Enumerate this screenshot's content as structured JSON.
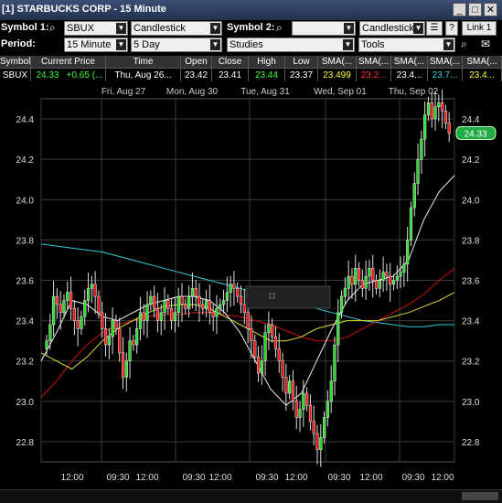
{
  "window": {
    "title": "[1] STARBUCKS CORP - 15 Minute",
    "buttons": [
      "_",
      "□",
      "✕"
    ]
  },
  "toolbar1": {
    "symbol1_label": "Symbol 1:",
    "symbol1_value": "SBUX",
    "chart_type": "Candlestick",
    "symbol2_label": "Symbol 2:",
    "symbol2_value": "",
    "chart_type2": "Candlestick",
    "help": "?",
    "link": "Link 1"
  },
  "toolbar2": {
    "period_label": "Period:",
    "period_value": "15 Minute",
    "range_value": "5 Day",
    "studies_value": "Studies",
    "tools_value": "Tools"
  },
  "quote": {
    "headers": [
      "Symbol",
      "Current Price",
      "Time",
      "Open",
      "Close",
      "High",
      "Low",
      "SMA(...",
      "SMA(...",
      "SMA(...",
      "SMA(...",
      "SMA(..."
    ],
    "values": [
      "SBUX",
      "24.33",
      "+0.65 (...",
      "Thu, Aug 26...",
      "23.42",
      "23.41",
      "23.44",
      "23.37",
      "23.499",
      "23.2...",
      "23.4...",
      "23.7...",
      "23.4..."
    ]
  },
  "chart_data": {
    "type": "candlestick",
    "symbol": "SBUX",
    "interval": "15 Minute",
    "date_labels": [
      "Fri, Aug 27",
      "Mon, Aug 30",
      "Tue, Aug 31",
      "Wed, Sep 01",
      "Thu, Sep 02"
    ],
    "time_labels": [
      "12:00",
      "09:30",
      "12:00",
      "09:30",
      "12:00",
      "09:30",
      "12:00",
      "09:30",
      "12:00",
      "09:30",
      "12:00"
    ],
    "y_ticks": [
      22.8,
      23.0,
      23.2,
      23.4,
      23.6,
      23.8,
      24.0,
      24.2,
      24.4
    ],
    "ylim": [
      22.7,
      24.5
    ],
    "x_count": 130,
    "last_price": "24.33",
    "grid": true,
    "closes": [
      23.3,
      23.38,
      23.52,
      23.48,
      23.44,
      23.5,
      23.54,
      23.46,
      23.4,
      23.36,
      23.42,
      23.5,
      23.56,
      23.58,
      23.52,
      23.44,
      23.36,
      23.28,
      23.32,
      23.4,
      23.36,
      23.24,
      23.12,
      23.2,
      23.3,
      23.28,
      23.36,
      23.44,
      23.4,
      23.48,
      23.52,
      23.46,
      23.4,
      23.44,
      23.5,
      23.46,
      23.4,
      23.44,
      23.52,
      23.48,
      23.46,
      23.52,
      23.56,
      23.52,
      23.48,
      23.46,
      23.5,
      23.44,
      23.42,
      23.46,
      23.48,
      23.5,
      23.54,
      23.58,
      23.56,
      23.52,
      23.48,
      23.44,
      23.36,
      23.3,
      23.22,
      23.14,
      23.2,
      23.34,
      23.38,
      23.32,
      23.26,
      23.2,
      23.12,
      23.04,
      23.1,
      23.0,
      22.92,
      22.96,
      23.04,
      22.98,
      22.9,
      22.84,
      22.76,
      22.82,
      22.92,
      23.0,
      23.1,
      23.28,
      23.44,
      23.52,
      23.56,
      23.62,
      23.58,
      23.66,
      23.6,
      23.56,
      23.62,
      23.66,
      23.6,
      23.56,
      23.6,
      23.64,
      23.62,
      23.58,
      23.6,
      23.62,
      23.64,
      23.68,
      23.8,
      23.96,
      24.08,
      24.2,
      24.3,
      24.42,
      24.48,
      24.4,
      24.46,
      24.48,
      24.44,
      24.38,
      24.33
    ],
    "series": [
      {
        "name": "SMA (cyan)",
        "color": "#33ccdd",
        "values": [
          23.78,
          23.77,
          23.76,
          23.75,
          23.74,
          23.72,
          23.7,
          23.68,
          23.66,
          23.64,
          23.62,
          23.6,
          23.58,
          23.56,
          23.54,
          23.52,
          23.5,
          23.48,
          23.46,
          23.44,
          23.42,
          23.4,
          23.39,
          23.38,
          23.37,
          23.37,
          23.38,
          23.38
        ]
      },
      {
        "name": "SMA (red)",
        "color": "#cc1111",
        "values": [
          23.02,
          23.1,
          23.2,
          23.28,
          23.34,
          23.38,
          23.4,
          23.42,
          23.43,
          23.43,
          23.44,
          23.44,
          23.43,
          23.42,
          23.4,
          23.38,
          23.35,
          23.32,
          23.3,
          23.3,
          23.32,
          23.36,
          23.4,
          23.44,
          23.48,
          23.53,
          23.6,
          23.66
        ]
      },
      {
        "name": "SMA (yellow)",
        "color": "#dddd33",
        "values": [
          23.24,
          23.2,
          23.16,
          23.22,
          23.3,
          23.36,
          23.4,
          23.44,
          23.47,
          23.48,
          23.48,
          23.46,
          23.42,
          23.38,
          23.34,
          23.3,
          23.3,
          23.32,
          23.36,
          23.38,
          23.4,
          23.4,
          23.4,
          23.42,
          23.44,
          23.47,
          23.5,
          23.54
        ]
      },
      {
        "name": "SMA (white)",
        "color": "#f0f0f0",
        "values": [
          23.2,
          23.34,
          23.5,
          23.48,
          23.42,
          23.4,
          23.44,
          23.48,
          23.5,
          23.52,
          23.52,
          23.5,
          23.44,
          23.34,
          23.2,
          23.06,
          22.98,
          23.04,
          23.2,
          23.36,
          23.5,
          23.58,
          23.6,
          23.62,
          23.7,
          23.9,
          24.04,
          24.12
        ]
      }
    ]
  }
}
